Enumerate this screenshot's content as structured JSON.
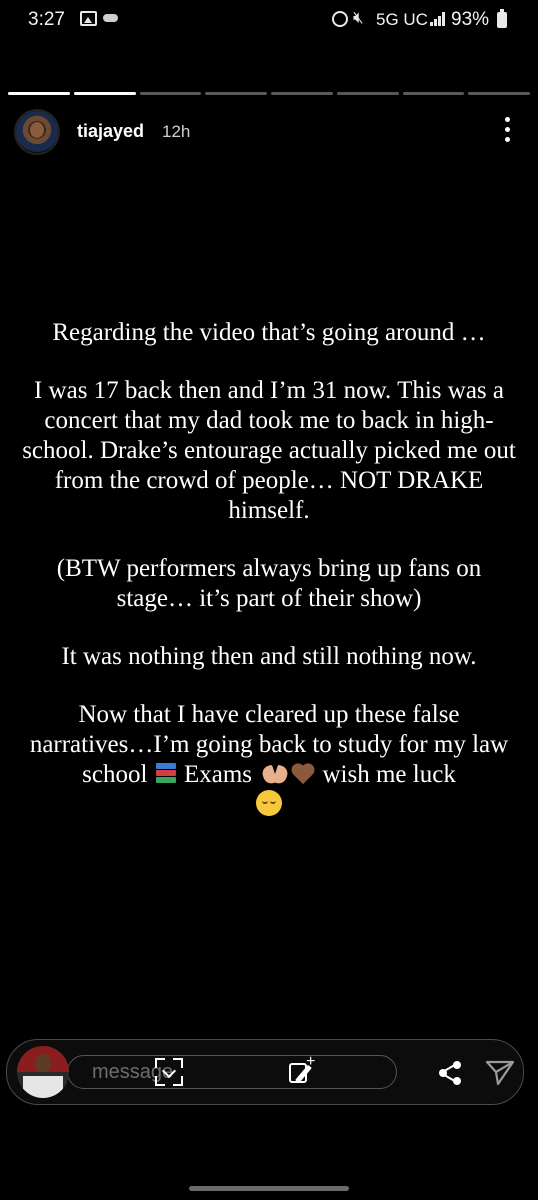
{
  "status_bar": {
    "time": "3:27",
    "network": "5G UC",
    "battery": "93%",
    "icons": [
      "gallery-icon",
      "cloud-icon",
      "alarm-icon",
      "mute-icon",
      "signal-icon",
      "battery-icon"
    ]
  },
  "story_progress": {
    "segments": 8,
    "current_index": 1,
    "completed_fraction": [
      1,
      1,
      0,
      0,
      0,
      0,
      0,
      0
    ]
  },
  "header": {
    "username": "tiajayed",
    "time_ago": "12h",
    "icons": [
      "avatar",
      "more-vertical-icon"
    ]
  },
  "story_text": {
    "p1": "Regarding the video that’s going around …",
    "p2": "I was 17 back then and I’m 31 now. This was a concert that my dad took me to back in high-school. Drake’s entourage actually picked me out from the crowd of people… NOT DRAKE himself.",
    "p3": "(BTW performers always bring up fans on stage… it’s part of their show)",
    "p4": "It was nothing then and still nothing now.",
    "p5_a": "Now that I have cleared up these false narratives…I’m going back to study for my law school",
    "p5_b": "Exams",
    "p5_c": "wish me luck",
    "emojis": [
      "books-emoji",
      "heart-hands-emoji",
      "brown-heart-emoji",
      "relieved-face-emoji"
    ]
  },
  "bottom_bar": {
    "message_placeholder": "message",
    "icons": [
      "scan-icon",
      "edit-sticker-icon",
      "share-icon",
      "send-icon"
    ]
  },
  "colors": {
    "background": "#000000",
    "text": "#ffffff",
    "muted": "#cfcfcf",
    "bar_border": "#4a4a4a"
  }
}
